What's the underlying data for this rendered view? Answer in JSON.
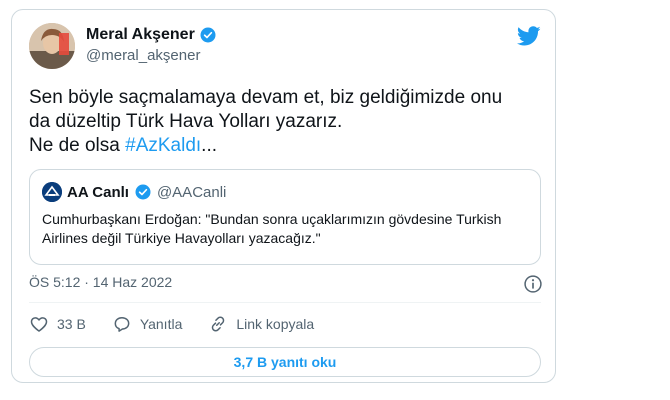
{
  "tweet": {
    "author_name": "Meral Akşener",
    "author_handle": "@meral_akşener",
    "text_line1": "Sen böyle saçmalamaya devam et, biz geldiğimizde onu",
    "text_line2": "da düzeltip Türk Hava Yolları yazarız.",
    "text_line3_prefix": "Ne de olsa ",
    "hashtag": "#AzKaldı",
    "text_line3_suffix": "...",
    "timestamp": "ÖS 5:12 · 14 Haz 2022"
  },
  "quote": {
    "author_name": "AA Canlı",
    "author_handle": "@AACanli",
    "text": "Cumhurbaşkanı Erdoğan: \"Bundan sonra uçaklarımızın gövdesine Turkish Airlines değil Türkiye Havayolları yazacağız.\""
  },
  "actions": {
    "like_count": "33 B",
    "reply_label": "Yanıtla",
    "copy_link_label": "Link kopyala"
  },
  "replies_button_label": "3,7 B yanıtı oku",
  "colors": {
    "accent": "#1d9bf0",
    "text": "#0f1419",
    "muted": "#536471",
    "border": "#cfd9de"
  },
  "icons": [
    "avatar",
    "verified-icon",
    "twitter-bird-icon",
    "info-icon",
    "heart-icon",
    "reply-icon",
    "link-icon"
  ]
}
